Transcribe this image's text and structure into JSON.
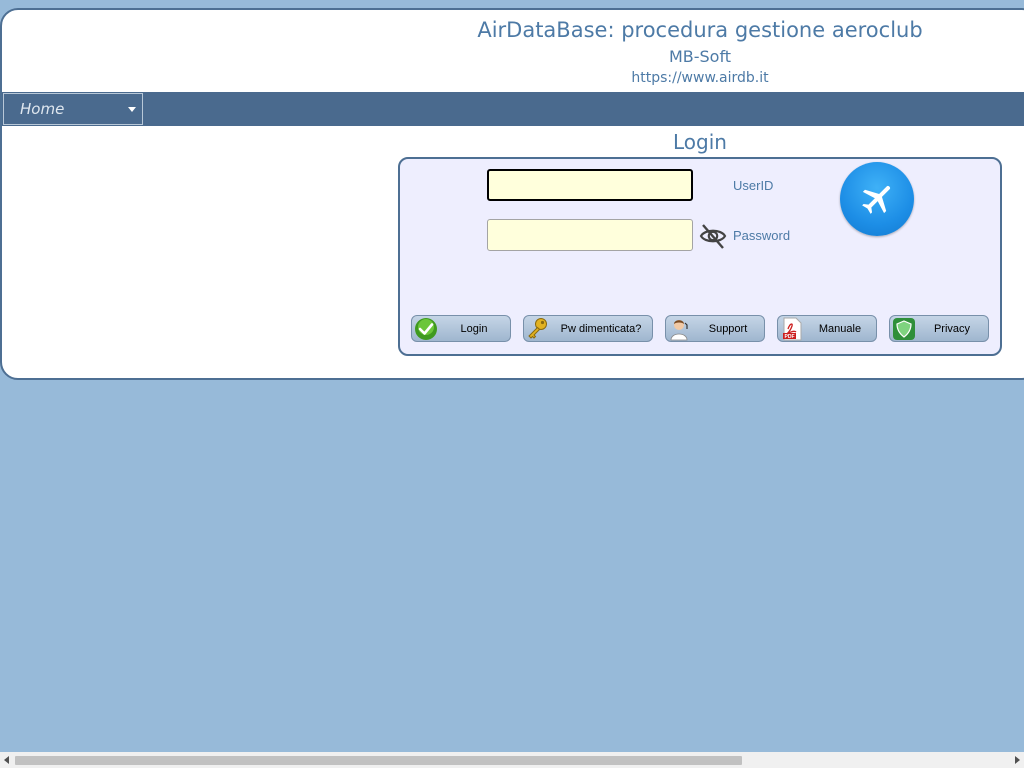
{
  "header": {
    "title": "AirDataBase: procedura gestione aeroclub",
    "subtitle": "MB-Soft",
    "url": "https://www.airdb.it"
  },
  "nav": {
    "home_select": "Home"
  },
  "login": {
    "title": "Login",
    "userid_label": "UserID",
    "userid_value": "",
    "password_label": "Password",
    "password_value": ""
  },
  "buttons": {
    "login": "Login",
    "forgot": "Pw dimenticata?",
    "support": "Support",
    "manual": "Manuale",
    "privacy": "Privacy"
  },
  "icons": {
    "eye": "eye-slash-icon",
    "plane": "airplane-icon",
    "login": "green-check-icon",
    "forgot": "key-icon",
    "support": "support-person-icon",
    "manual": "pdf-icon",
    "privacy": "shield-icon"
  },
  "colors": {
    "background": "#97bad9",
    "navbar": "#4a6a8e",
    "accent_text": "#4d7aa6",
    "input_bg": "#ffffdc",
    "panel_bg": "#eeeefe"
  }
}
